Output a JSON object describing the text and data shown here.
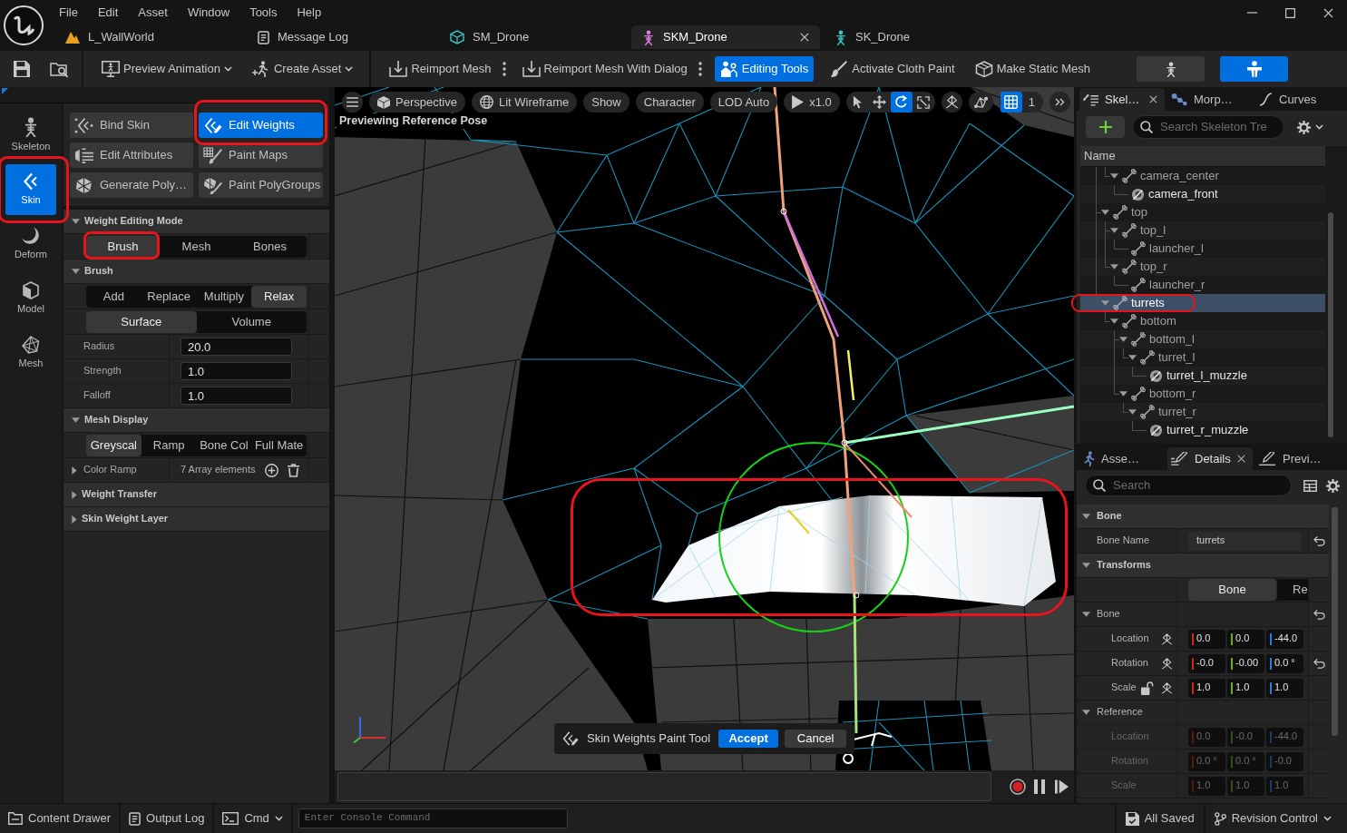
{
  "menu": [
    "File",
    "Edit",
    "Asset",
    "Window",
    "Tools",
    "Help"
  ],
  "document_tabs": [
    {
      "label": "L_WallWorld",
      "selected": false
    },
    {
      "label": "Message Log",
      "selected": false
    },
    {
      "label": "SM_Drone",
      "selected": false
    },
    {
      "label": "SKM_Drone",
      "selected": true
    },
    {
      "label": "SK_Drone",
      "selected": false
    }
  ],
  "toolbar": {
    "buttons": [
      {
        "label": "Preview Animation",
        "kind": "dropdown",
        "selected": false
      },
      {
        "label": "Create Asset",
        "kind": "dropdown",
        "selected": false
      },
      {
        "label": "Reimport Mesh",
        "kind": "more",
        "selected": false
      },
      {
        "label": "Reimport Mesh With Dialog",
        "kind": "more",
        "selected": false
      },
      {
        "label": "Editing Tools",
        "kind": "plain",
        "selected": true
      },
      {
        "label": "Activate Cloth Paint",
        "kind": "plain",
        "selected": false
      },
      {
        "label": "Make Static Mesh",
        "kind": "plain",
        "selected": false
      }
    ],
    "view_modes": [
      {
        "selected": false
      },
      {
        "selected": true
      }
    ]
  },
  "modes": [
    {
      "label": "Skeleton",
      "selected": false,
      "highlighted": false
    },
    {
      "label": "Skin",
      "selected": true,
      "highlighted": true
    },
    {
      "label": "Deform",
      "selected": false,
      "highlighted": false
    },
    {
      "label": "Model",
      "selected": false,
      "highlighted": false
    },
    {
      "label": "Mesh",
      "selected": false,
      "highlighted": false
    }
  ],
  "tools": [
    {
      "label": "Bind Skin",
      "selected": false,
      "highlighted": false
    },
    {
      "label": "Edit Weights",
      "selected": true,
      "highlighted": true
    },
    {
      "label": "Edit Attributes",
      "selected": false,
      "highlighted": false
    },
    {
      "label": "Paint Maps",
      "selected": false,
      "highlighted": false
    },
    {
      "label": "Generate Poly…",
      "selected": false,
      "highlighted": false
    },
    {
      "label": "Paint PolyGroups",
      "selected": false,
      "highlighted": false
    }
  ],
  "tool_settings": [
    {
      "title": "Weight Editing Mode",
      "expanded": true,
      "rows": [
        {
          "kind": "segmented",
          "options": [
            {
              "label": "Brush",
              "selected": true,
              "highlighted": true
            },
            {
              "label": "Mesh",
              "selected": false,
              "highlighted": false
            },
            {
              "label": "Bones",
              "selected": false,
              "highlighted": false
            }
          ]
        }
      ]
    },
    {
      "title": "Brush",
      "expanded": true,
      "rows": [
        {
          "kind": "segmented",
          "options": [
            {
              "label": "Add",
              "selected": false
            },
            {
              "label": "Replace",
              "selected": false
            },
            {
              "label": "Multiply",
              "selected": false
            },
            {
              "label": "Relax",
              "selected": true
            }
          ]
        },
        {
          "kind": "segmented",
          "options": [
            {
              "label": "Surface",
              "selected": true
            },
            {
              "label": "Volume",
              "selected": false
            }
          ]
        },
        {
          "kind": "number",
          "label": "Radius",
          "value": "20.0"
        },
        {
          "kind": "number",
          "label": "Strength",
          "value": "1.0"
        },
        {
          "kind": "number",
          "label": "Falloff",
          "value": "1.0"
        }
      ]
    },
    {
      "title": "Mesh Display",
      "expanded": true,
      "rows": [
        {
          "kind": "segmented",
          "options": [
            {
              "label": "Greyscal",
              "selected": true
            },
            {
              "label": "Ramp",
              "selected": false
            },
            {
              "label": "Bone Col",
              "selected": false
            },
            {
              "label": "Full Mate",
              "selected": false
            }
          ]
        },
        {
          "kind": "array",
          "label": "Color Ramp",
          "value": "7 Array elements",
          "expanded": false
        }
      ]
    },
    {
      "title": "Weight Transfer",
      "expanded": false
    },
    {
      "title": "Skin Weight Layer",
      "expanded": false
    }
  ],
  "viewport": {
    "toolbar": [
      {
        "label": "Perspective"
      },
      {
        "label": "Lit Wireframe"
      },
      {
        "label": "Show"
      },
      {
        "label": "Character"
      },
      {
        "label": "LOD Auto"
      },
      {
        "label": "x1.0"
      }
    ],
    "transform_tools": [
      {
        "selected": false
      },
      {
        "selected": false
      },
      {
        "selected": true
      },
      {
        "selected": false
      }
    ],
    "grid_snap": {
      "on": true,
      "value": "1"
    },
    "status_text": "Previewing Reference Pose",
    "mesh_highlighted": true,
    "tool_prompt": {
      "label": "Skin Weights Paint Tool",
      "buttons": [
        {
          "label": "Accept",
          "kind": "primary"
        },
        {
          "label": "Cancel",
          "kind": "secondary"
        }
      ]
    }
  },
  "skeleton_panel": {
    "tabs": [
      {
        "label": "Skel…",
        "selected": true
      },
      {
        "label": "Morp…",
        "selected": false
      },
      {
        "label": "Curves",
        "selected": false
      }
    ],
    "search": {
      "placeholder": "Search Skeleton Tre"
    },
    "column": "Name",
    "tree": [
      {
        "children": [
          {
            "label": "camera_center",
            "kind": "bone",
            "expanded": true,
            "selected": false,
            "highlighted": false,
            "children": [
              {
                "label": "camera_front",
                "kind": "socket",
                "selected": false,
                "highlighted": false
              }
            ]
          }
        ]
      },
      {
        "label": "top",
        "kind": "bone",
        "expanded": true,
        "selected": false,
        "highlighted": false,
        "children": [
          {
            "label": "top_l",
            "kind": "bone",
            "expanded": true,
            "selected": false,
            "highlighted": false,
            "children": [
              {
                "label": "launcher_l",
                "kind": "bone",
                "selected": false,
                "highlighted": false
              }
            ]
          },
          {
            "label": "top_r",
            "kind": "bone",
            "expanded": true,
            "selected": false,
            "highlighted": false,
            "children": [
              {
                "label": "launcher_r",
                "kind": "bone",
                "selected": false,
                "highlighted": false
              }
            ]
          }
        ]
      },
      {
        "label": "turrets",
        "kind": "bone",
        "expanded": true,
        "selected": true,
        "highlighted": true,
        "children": [
          {
            "label": "bottom",
            "kind": "bone",
            "expanded": true,
            "selected": false,
            "highlighted": false,
            "children": [
              {
                "label": "bottom_l",
                "kind": "bone",
                "expanded": true,
                "selected": false,
                "highlighted": false,
                "children": [
                  {
                    "label": "turret_l",
                    "kind": "bone",
                    "expanded": true,
                    "selected": false,
                    "highlighted": false,
                    "children": [
                      {
                        "label": "turret_l_muzzle",
                        "kind": "socket",
                        "selected": false,
                        "highlighted": false
                      }
                    ]
                  }
                ]
              },
              {
                "label": "bottom_r",
                "kind": "bone",
                "expanded": true,
                "selected": false,
                "highlighted": false,
                "children": [
                  {
                    "label": "turret_r",
                    "kind": "bone",
                    "expanded": true,
                    "selected": false,
                    "highlighted": false,
                    "children": [
                      {
                        "label": "turret_r_muzzle",
                        "kind": "socket",
                        "selected": false,
                        "highlighted": false
                      }
                    ]
                  }
                ]
              }
            ]
          }
        ]
      }
    ]
  },
  "details_panel": {
    "tabs": [
      {
        "label": "Asse…",
        "selected": false
      },
      {
        "label": "Details",
        "selected": true
      },
      {
        "label": "Previ…",
        "selected": false
      }
    ],
    "search": {
      "placeholder": "Search"
    },
    "sections": [
      {
        "title": "Bone",
        "expanded": true,
        "rows": [
          {
            "kind": "text",
            "label": "Bone Name",
            "value": "turrets",
            "resettable": true
          }
        ]
      },
      {
        "title": "Transforms",
        "expanded": true,
        "rows": [
          {
            "kind": "segmented",
            "options": [
              {
                "label": "Bone",
                "selected": true
              },
              {
                "label": "Re",
                "selected": false
              }
            ]
          },
          {
            "kind": "group",
            "label": "Bone",
            "expanded": true,
            "resettable": true
          },
          {
            "kind": "vector",
            "label": "Location",
            "values": [
              "0.0",
              "0.0",
              "-44.0"
            ],
            "resettable": false,
            "disabled": false
          },
          {
            "kind": "vector",
            "label": "Rotation",
            "values": [
              "-0.0",
              "-0.00",
              "0.0 °"
            ],
            "resettable": true,
            "disabled": false
          },
          {
            "kind": "vector",
            "label": "Scale",
            "values": [
              "1.0",
              "1.0",
              "1.0"
            ],
            "resettable": false,
            "disabled": false,
            "locked": false
          },
          {
            "kind": "group",
            "label": "Reference",
            "expanded": true,
            "resettable": false
          },
          {
            "kind": "vector",
            "label": "Location",
            "values": [
              "0.0",
              "-0.0",
              "-44.0"
            ],
            "resettable": false,
            "disabled": true
          },
          {
            "kind": "vector",
            "label": "Rotation",
            "values": [
              "0.0 °",
              "0.0 °",
              "-0.0"
            ],
            "resettable": false,
            "disabled": true
          },
          {
            "kind": "vector",
            "label": "Scale",
            "values": [
              "1.0",
              "1.0",
              "1.0"
            ],
            "resettable": false,
            "disabled": true
          }
        ]
      }
    ]
  },
  "status_bar": {
    "buttons": [
      {
        "label": "Content Drawer",
        "dropdown": false
      },
      {
        "label": "Output Log",
        "dropdown": false
      },
      {
        "label": "Cmd",
        "dropdown": true
      }
    ],
    "console": {
      "placeholder": "Enter Console Command"
    },
    "right": [
      {
        "label": "All Saved",
        "dropdown": false
      },
      {
        "label": "Revision Control",
        "dropdown": true
      }
    ]
  }
}
